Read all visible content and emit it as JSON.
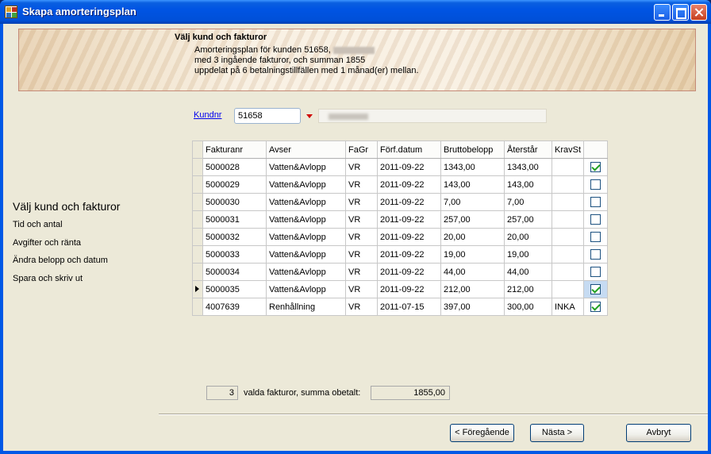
{
  "window": {
    "title": "Skapa amorteringsplan"
  },
  "header": {
    "title": "Välj kund och fakturor",
    "line1": "Amorteringsplan för kunden 51658,",
    "line2": "med 3 ingående fakturor, och summan 1855",
    "line3": "uppdelat på 6 betalningstillfällen med 1 månad(er) mellan."
  },
  "steps": {
    "active": "Välj kund och fakturor",
    "items": [
      "Tid och antal",
      "Avgifter och ränta",
      "Ändra belopp och datum",
      "Spara och skriv ut"
    ]
  },
  "customer": {
    "link_label": "Kundnr",
    "number": "51658",
    "dropdown_icon": "red-triangle-down-icon"
  },
  "table": {
    "columns": [
      "Fakturanr",
      "Avser",
      "FaGr",
      "Förf.datum",
      "Bruttobelopp",
      "Återstår",
      "KravSt",
      ""
    ],
    "rows": [
      {
        "fakturanr": "5000028",
        "avser": "Vatten&Avlopp",
        "fagr": "VR",
        "forf": "2011-09-22",
        "brutto": "1343,00",
        "aterstar": "1343,00",
        "kravst": "",
        "checked": true
      },
      {
        "fakturanr": "5000029",
        "avser": "Vatten&Avlopp",
        "fagr": "VR",
        "forf": "2011-09-22",
        "brutto": "143,00",
        "aterstar": "143,00",
        "kravst": "",
        "checked": false
      },
      {
        "fakturanr": "5000030",
        "avser": "Vatten&Avlopp",
        "fagr": "VR",
        "forf": "2011-09-22",
        "brutto": "7,00",
        "aterstar": "7,00",
        "kravst": "",
        "checked": false
      },
      {
        "fakturanr": "5000031",
        "avser": "Vatten&Avlopp",
        "fagr": "VR",
        "forf": "2011-09-22",
        "brutto": "257,00",
        "aterstar": "257,00",
        "kravst": "",
        "checked": false
      },
      {
        "fakturanr": "5000032",
        "avser": "Vatten&Avlopp",
        "fagr": "VR",
        "forf": "2011-09-22",
        "brutto": "20,00",
        "aterstar": "20,00",
        "kravst": "",
        "checked": false
      },
      {
        "fakturanr": "5000033",
        "avser": "Vatten&Avlopp",
        "fagr": "VR",
        "forf": "2011-09-22",
        "brutto": "19,00",
        "aterstar": "19,00",
        "kravst": "",
        "checked": false
      },
      {
        "fakturanr": "5000034",
        "avser": "Vatten&Avlopp",
        "fagr": "VR",
        "forf": "2011-09-22",
        "brutto": "44,00",
        "aterstar": "44,00",
        "kravst": "",
        "checked": false
      },
      {
        "fakturanr": "5000035",
        "avser": "Vatten&Avlopp",
        "fagr": "VR",
        "forf": "2011-09-22",
        "brutto": "212,00",
        "aterstar": "212,00",
        "kravst": "",
        "checked": true,
        "current": true
      },
      {
        "fakturanr": "4007639",
        "avser": "Renhållning",
        "fagr": "VR",
        "forf": "2011-07-15",
        "brutto": "397,00",
        "aterstar": "300,00",
        "kravst": "INKA",
        "checked": true
      }
    ]
  },
  "summary": {
    "count": "3",
    "label": "valda fakturor, summa obetalt:",
    "sum": "1855,00"
  },
  "buttons": {
    "prev": "< Föregående",
    "next": "Nästa >",
    "cancel": "Avbryt"
  }
}
